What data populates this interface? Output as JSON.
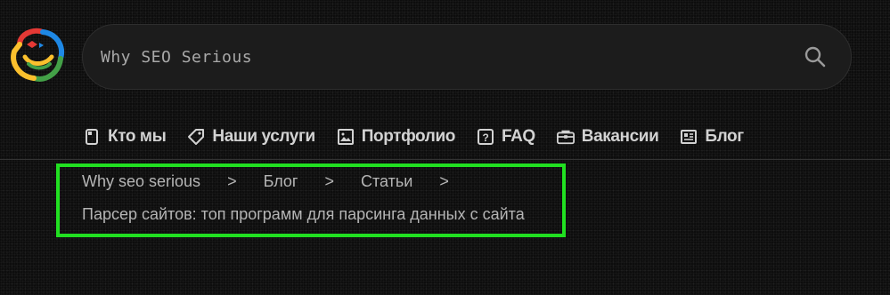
{
  "search": {
    "placeholder": "Why SEO Serious"
  },
  "logo": {
    "icon": "smiley-logo-icon",
    "colors": [
      "#e53935",
      "#1e88e5",
      "#fbc02d",
      "#43a047"
    ]
  },
  "nav": {
    "items": [
      {
        "label": "Кто мы",
        "icon": "phone-icon"
      },
      {
        "label": "Наши услуги",
        "icon": "tag-icon"
      },
      {
        "label": "Портфолио",
        "icon": "image-icon"
      },
      {
        "label": "FAQ",
        "icon": "question-icon"
      },
      {
        "label": "Вакансии",
        "icon": "briefcase-icon"
      },
      {
        "label": "Блог",
        "icon": "newspaper-icon"
      }
    ]
  },
  "breadcrumb": {
    "items": [
      {
        "label": "Why seo serious"
      },
      {
        "label": "Блог"
      },
      {
        "label": "Статьи"
      }
    ],
    "separator": ">",
    "current": "Парсер сайтов: топ программ для парсинга данных с сайта"
  },
  "highlight_color": "#21e021"
}
